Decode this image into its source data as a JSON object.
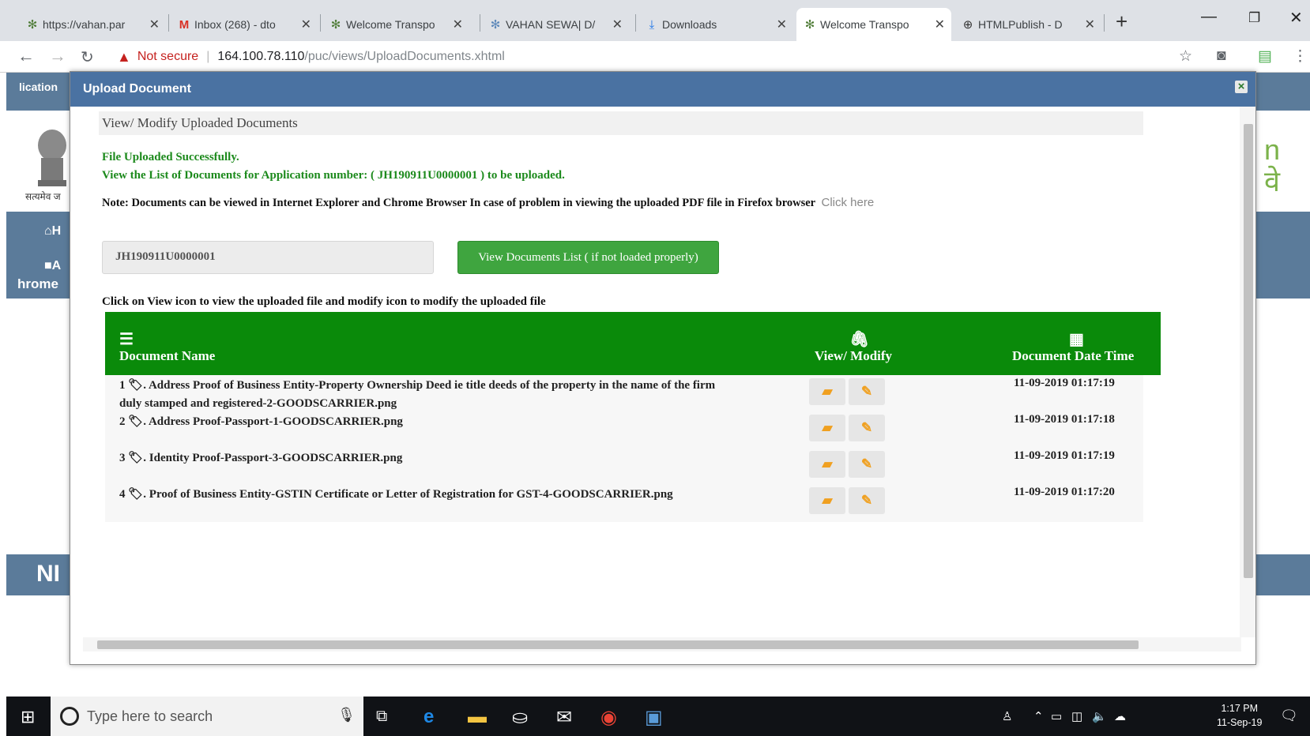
{
  "browser": {
    "tabs": [
      {
        "title": "https://vahan.par",
        "icon": "globe-leaf-icon"
      },
      {
        "title": "Inbox (268) - dto",
        "icon": "gmail-icon"
      },
      {
        "title": "Welcome Transpo",
        "icon": "globe-leaf-icon"
      },
      {
        "title": "VAHAN SEWA| D/",
        "icon": "globe-leaf-icon"
      },
      {
        "title": "Downloads",
        "icon": "download-icon"
      },
      {
        "title": "Welcome Transpo",
        "icon": "globe-leaf-icon"
      },
      {
        "title": "HTMLPublish - D",
        "icon": "globe-icon"
      }
    ],
    "active_tab": 5,
    "security_label": "Not secure",
    "url_host": "164.100.78.110",
    "url_path": "/puc/views/UploadDocuments.xhtml"
  },
  "background": {
    "topbar_text": "lication",
    "emblem_caption": "सत्यमेव ज",
    "nav_home": "H",
    "nav_second": "A",
    "breadcrumb": "hrome",
    "right_text": "n\nवे",
    "footer_text": "NI"
  },
  "modal": {
    "title": "Upload Document",
    "close_label": "×",
    "section_heading": "View/ Modify Uploaded Documents",
    "success_message": "File Uploaded Successfully.",
    "list_message": "View the List of Documents for Application number: ( JH190911U0000001 ) to be uploaded.",
    "note_text": "Note: Documents can be viewed in Internet Explorer and Chrome Browser In case of problem in viewing the uploaded PDF file in Firefox browser",
    "note_link": "Click here",
    "application_number": "JH190911U0000001",
    "view_button_label": "View Documents List ( if not loaded properly)",
    "instruction": "Click on View icon to view the uploaded file and modify icon to modify the uploaded file",
    "table": {
      "headers": {
        "name": "Document Name",
        "view": "View/ Modify",
        "date": "Document Date Time"
      },
      "rows": [
        {
          "label": "1 🏷. Address Proof of Business Entity-Property Ownership Deed ie title deeds of the property in the name of the firm duly stamped and registered-2-GOODSCARRIER.png",
          "date": "11-09-2019 01:17:19"
        },
        {
          "label": "2 🏷. Address Proof-Passport-1-GOODSCARRIER.png",
          "date": "11-09-2019 01:17:18"
        },
        {
          "label": "3 🏷. Identity Proof-Passport-3-GOODSCARRIER.png",
          "date": "11-09-2019 01:17:19"
        },
        {
          "label": "4 🏷. Proof of Business Entity-GSTIN Certificate or Letter of Registration for GST-4-GOODSCARRIER.png",
          "date": "11-09-2019 01:17:20"
        }
      ]
    }
  },
  "taskbar": {
    "search_placeholder": "Type here to search",
    "time": "1:17 PM",
    "date": "11-Sep-19"
  },
  "colors": {
    "modal_header": "#4a72a2",
    "table_header": "#0a8a0a",
    "success_text": "#1c8a1c",
    "action_icon": "#f0a020"
  }
}
